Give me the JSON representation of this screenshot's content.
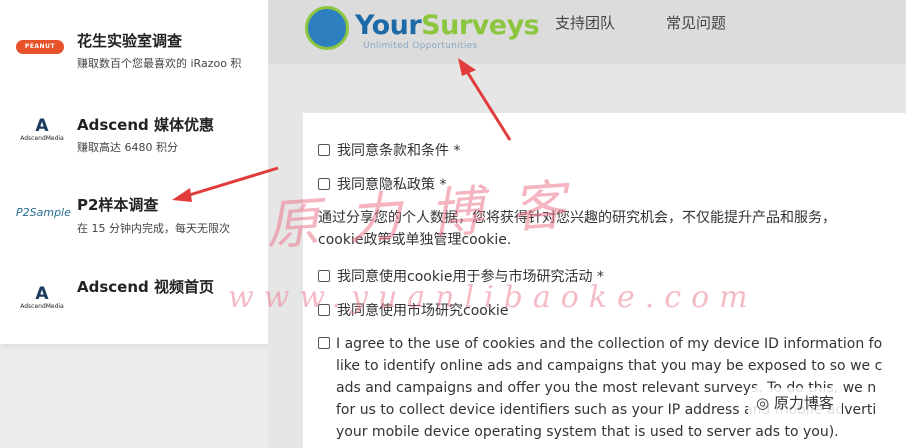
{
  "left_panel": {
    "items": [
      {
        "logo_text": "PEANUT LABS",
        "title": "花生实验室调查",
        "desc": "赚取数百个您最喜欢的 iRazoo 积"
      },
      {
        "logo_text": "A",
        "logo_sub": "AdscendMedia",
        "title": "Adscend 媒体优惠",
        "desc": "赚取高达 6480 积分"
      },
      {
        "logo_text": "P2Sample",
        "title": "P2样本调查",
        "desc": "在 15 分钟内完成，每天无限次"
      },
      {
        "logo_text": "A",
        "logo_sub": "AdscendMedia",
        "title": "Adscend 视频首页",
        "desc": ""
      }
    ]
  },
  "header": {
    "logo_your": "Your",
    "logo_surveys": "Surveys",
    "logo_tagline": "Unlimited Opportunities",
    "nav": [
      "支持团队",
      "常见问题"
    ]
  },
  "form": {
    "checkbox_terms": "我同意条款和条件 *",
    "checkbox_privacy": "我同意隐私政策 *",
    "paragraph_line1": "通过分享您的个人数据，您将获得针对您兴趣的研究机会，不仅能提升产品和服务，",
    "paragraph_line2": "cookie政策或单独管理cookie.",
    "checkbox_cookie_research": "我同意使用cookie用于参与市场研究活动 *",
    "checkbox_cookie_market": "我同意使用市场研究cookie",
    "english_lines": [
      "I agree to the use of cookies and the collection of my device ID information fo",
      "like to identify online ads and campaigns that you may be exposed to so we c",
      "ads and campaigns and offer you the most relevant surveys. To do this, we n",
      "for us to collect device identifiers such as your IP address and mobile adverti",
      "your mobile device operating system that is used to server ads to you)."
    ]
  },
  "watermark": {
    "cn": "原力博客",
    "url": "www.yuanlibaoke.com",
    "badge": "原力博客"
  },
  "colors": {
    "accent_blue": "#1c6aa8",
    "accent_green": "#8cc63f",
    "arrow_red": "#e23b3b",
    "watermark_pink": "#eb788c"
  }
}
